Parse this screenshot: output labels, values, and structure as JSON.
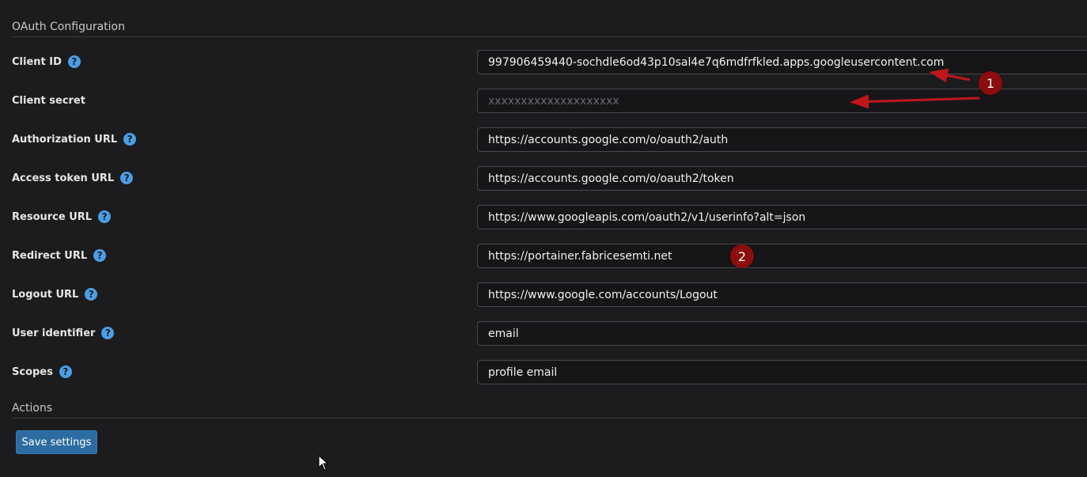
{
  "sections": {
    "oauth_title": "OAuth Configuration",
    "actions_title": "Actions"
  },
  "fields": {
    "client_id": {
      "label": "Client ID",
      "value": "997906459440-sochdle6od43p10sal4e7q6mdfrfkled.apps.googleusercontent.com"
    },
    "client_secret": {
      "label": "Client secret",
      "placeholder": "xxxxxxxxxxxxxxxxxxxx"
    },
    "authorization_url": {
      "label": "Authorization URL",
      "value": "https://accounts.google.com/o/oauth2/auth"
    },
    "access_token_url": {
      "label": "Access token URL",
      "value": "https://accounts.google.com/o/oauth2/token"
    },
    "resource_url": {
      "label": "Resource URL",
      "value": "https://www.googleapis.com/oauth2/v1/userinfo?alt=json"
    },
    "redirect_url": {
      "label": "Redirect URL",
      "value": "https://portainer.fabricesemti.net"
    },
    "logout_url": {
      "label": "Logout URL",
      "value": "https://www.google.com/accounts/Logout"
    },
    "user_identifier": {
      "label": "User identifier",
      "value": "email"
    },
    "scopes": {
      "label": "Scopes",
      "value": "profile email"
    }
  },
  "help_glyph": "?",
  "actions": {
    "save_label": "Save settings"
  },
  "annotations": {
    "badge1": "1",
    "badge2": "2"
  },
  "colors": {
    "background": "#1c1c1e",
    "help_icon": "#4b9ee5",
    "primary_button": "#2d6ca2",
    "annotation_red": "#c0161a",
    "badge_fill": "#8b0d0d"
  }
}
